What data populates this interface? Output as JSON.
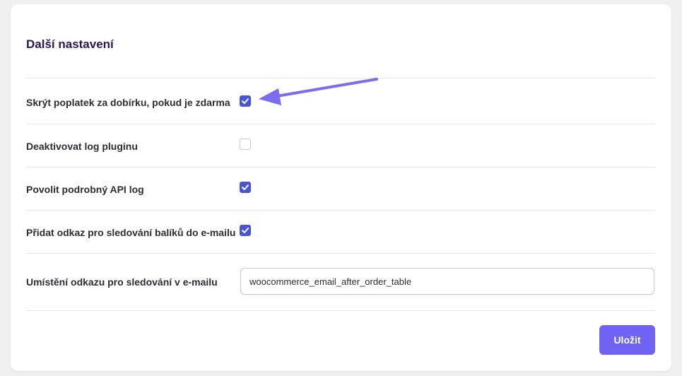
{
  "section": {
    "title": "Další nastavení"
  },
  "settings": [
    {
      "label": "Skrýt poplatek za dobírku, pokud je zdarma",
      "checked": true
    },
    {
      "label": "Deaktivovat log pluginu",
      "checked": false
    },
    {
      "label": "Povolit podrobný API log",
      "checked": true
    },
    {
      "label": "Přidat odkaz pro sledování balíků do e-mailu",
      "checked": true
    }
  ],
  "tracking_link": {
    "label": "Umístění odkazu pro sledování v e-mailu",
    "value": "woocommerce_email_after_order_table"
  },
  "actions": {
    "save_label": "Uložit"
  },
  "colors": {
    "accent": "#7062f2",
    "checkbox": "#4a55d4",
    "title": "#2b1656",
    "annotation_arrow": "#7b6cf0"
  },
  "icons": {
    "checkmark": "checkmark-icon",
    "annotation": "annotation-arrow-icon"
  }
}
